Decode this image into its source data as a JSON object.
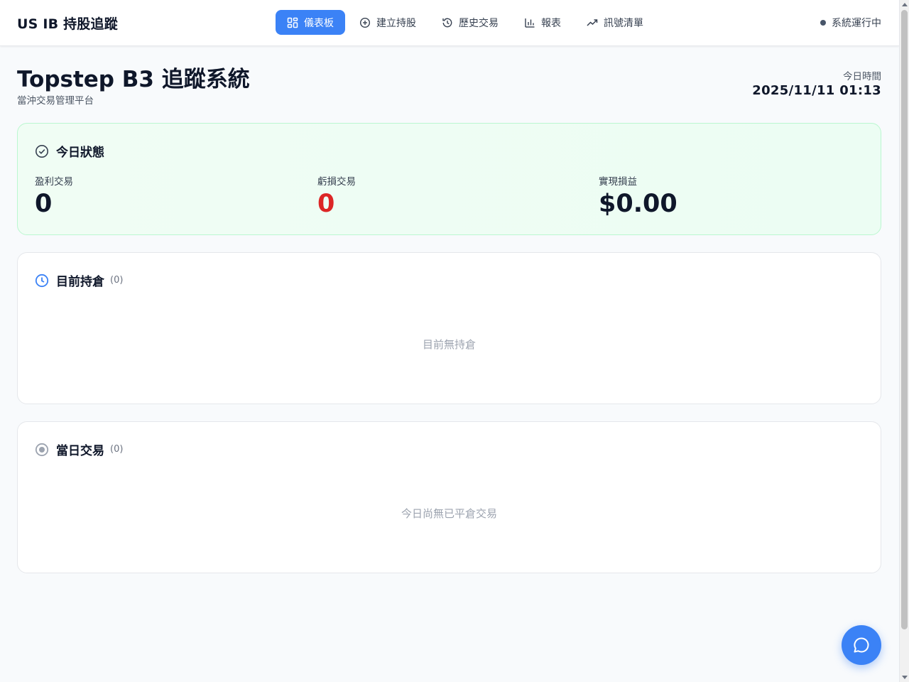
{
  "app": {
    "brand": "US IB 持股追蹤",
    "system_status": "系統運行中"
  },
  "nav": {
    "items": [
      {
        "label": "儀表板",
        "icon": "dashboard-icon",
        "active": true
      },
      {
        "label": "建立持股",
        "icon": "plus-circle-icon",
        "active": false
      },
      {
        "label": "歷史交易",
        "icon": "history-icon",
        "active": false
      },
      {
        "label": "報表",
        "icon": "bar-chart-icon",
        "active": false
      },
      {
        "label": "訊號清單",
        "icon": "trending-up-icon",
        "active": false
      }
    ]
  },
  "header": {
    "title": "Topstep B3 追蹤系統",
    "subtitle": "當沖交易管理平台",
    "time_label": "今日時間",
    "time_value": "2025/11/11 01:13"
  },
  "today_status": {
    "title": "今日狀態",
    "icon": "check-circle-icon",
    "stats": [
      {
        "label": "盈利交易",
        "value": "0"
      },
      {
        "label": "虧損交易",
        "value": "0"
      },
      {
        "label": "實現損益",
        "value": "$0.00"
      }
    ]
  },
  "positions": {
    "title": "目前持倉",
    "count": "(0)",
    "icon": "clock-icon",
    "empty_text": "目前無持倉"
  },
  "trades": {
    "title": "當日交易",
    "count": "(0)",
    "icon": "record-icon",
    "empty_text": "今日尚無已平倉交易"
  },
  "colors": {
    "accent": "#3b82f6",
    "loss": "#dc2626",
    "status_bg": "#f0fdf4",
    "status_border": "#bbf7d0"
  },
  "fab": {
    "icon": "chat-icon"
  }
}
